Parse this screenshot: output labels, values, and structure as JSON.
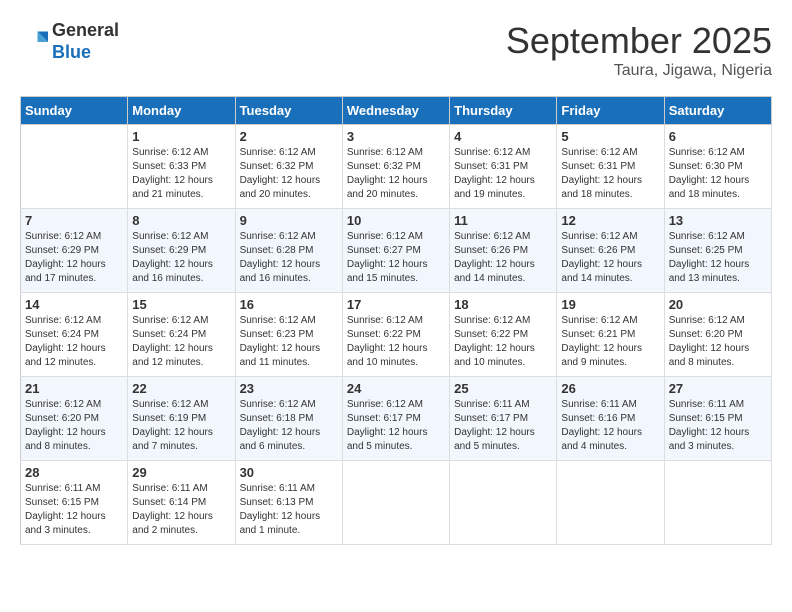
{
  "header": {
    "logo_general": "General",
    "logo_blue": "Blue",
    "month": "September 2025",
    "location": "Taura, Jigawa, Nigeria"
  },
  "weekdays": [
    "Sunday",
    "Monday",
    "Tuesday",
    "Wednesday",
    "Thursday",
    "Friday",
    "Saturday"
  ],
  "weeks": [
    [
      {
        "day": "",
        "info": ""
      },
      {
        "day": "1",
        "info": "Sunrise: 6:12 AM\nSunset: 6:33 PM\nDaylight: 12 hours\nand 21 minutes."
      },
      {
        "day": "2",
        "info": "Sunrise: 6:12 AM\nSunset: 6:32 PM\nDaylight: 12 hours\nand 20 minutes."
      },
      {
        "day": "3",
        "info": "Sunrise: 6:12 AM\nSunset: 6:32 PM\nDaylight: 12 hours\nand 20 minutes."
      },
      {
        "day": "4",
        "info": "Sunrise: 6:12 AM\nSunset: 6:31 PM\nDaylight: 12 hours\nand 19 minutes."
      },
      {
        "day": "5",
        "info": "Sunrise: 6:12 AM\nSunset: 6:31 PM\nDaylight: 12 hours\nand 18 minutes."
      },
      {
        "day": "6",
        "info": "Sunrise: 6:12 AM\nSunset: 6:30 PM\nDaylight: 12 hours\nand 18 minutes."
      }
    ],
    [
      {
        "day": "7",
        "info": "Sunrise: 6:12 AM\nSunset: 6:29 PM\nDaylight: 12 hours\nand 17 minutes."
      },
      {
        "day": "8",
        "info": "Sunrise: 6:12 AM\nSunset: 6:29 PM\nDaylight: 12 hours\nand 16 minutes."
      },
      {
        "day": "9",
        "info": "Sunrise: 6:12 AM\nSunset: 6:28 PM\nDaylight: 12 hours\nand 16 minutes."
      },
      {
        "day": "10",
        "info": "Sunrise: 6:12 AM\nSunset: 6:27 PM\nDaylight: 12 hours\nand 15 minutes."
      },
      {
        "day": "11",
        "info": "Sunrise: 6:12 AM\nSunset: 6:26 PM\nDaylight: 12 hours\nand 14 minutes."
      },
      {
        "day": "12",
        "info": "Sunrise: 6:12 AM\nSunset: 6:26 PM\nDaylight: 12 hours\nand 14 minutes."
      },
      {
        "day": "13",
        "info": "Sunrise: 6:12 AM\nSunset: 6:25 PM\nDaylight: 12 hours\nand 13 minutes."
      }
    ],
    [
      {
        "day": "14",
        "info": "Sunrise: 6:12 AM\nSunset: 6:24 PM\nDaylight: 12 hours\nand 12 minutes."
      },
      {
        "day": "15",
        "info": "Sunrise: 6:12 AM\nSunset: 6:24 PM\nDaylight: 12 hours\nand 12 minutes."
      },
      {
        "day": "16",
        "info": "Sunrise: 6:12 AM\nSunset: 6:23 PM\nDaylight: 12 hours\nand 11 minutes."
      },
      {
        "day": "17",
        "info": "Sunrise: 6:12 AM\nSunset: 6:22 PM\nDaylight: 12 hours\nand 10 minutes."
      },
      {
        "day": "18",
        "info": "Sunrise: 6:12 AM\nSunset: 6:22 PM\nDaylight: 12 hours\nand 10 minutes."
      },
      {
        "day": "19",
        "info": "Sunrise: 6:12 AM\nSunset: 6:21 PM\nDaylight: 12 hours\nand 9 minutes."
      },
      {
        "day": "20",
        "info": "Sunrise: 6:12 AM\nSunset: 6:20 PM\nDaylight: 12 hours\nand 8 minutes."
      }
    ],
    [
      {
        "day": "21",
        "info": "Sunrise: 6:12 AM\nSunset: 6:20 PM\nDaylight: 12 hours\nand 8 minutes."
      },
      {
        "day": "22",
        "info": "Sunrise: 6:12 AM\nSunset: 6:19 PM\nDaylight: 12 hours\nand 7 minutes."
      },
      {
        "day": "23",
        "info": "Sunrise: 6:12 AM\nSunset: 6:18 PM\nDaylight: 12 hours\nand 6 minutes."
      },
      {
        "day": "24",
        "info": "Sunrise: 6:12 AM\nSunset: 6:17 PM\nDaylight: 12 hours\nand 5 minutes."
      },
      {
        "day": "25",
        "info": "Sunrise: 6:11 AM\nSunset: 6:17 PM\nDaylight: 12 hours\nand 5 minutes."
      },
      {
        "day": "26",
        "info": "Sunrise: 6:11 AM\nSunset: 6:16 PM\nDaylight: 12 hours\nand 4 minutes."
      },
      {
        "day": "27",
        "info": "Sunrise: 6:11 AM\nSunset: 6:15 PM\nDaylight: 12 hours\nand 3 minutes."
      }
    ],
    [
      {
        "day": "28",
        "info": "Sunrise: 6:11 AM\nSunset: 6:15 PM\nDaylight: 12 hours\nand 3 minutes."
      },
      {
        "day": "29",
        "info": "Sunrise: 6:11 AM\nSunset: 6:14 PM\nDaylight: 12 hours\nand 2 minutes."
      },
      {
        "day": "30",
        "info": "Sunrise: 6:11 AM\nSunset: 6:13 PM\nDaylight: 12 hours\nand 1 minute."
      },
      {
        "day": "",
        "info": ""
      },
      {
        "day": "",
        "info": ""
      },
      {
        "day": "",
        "info": ""
      },
      {
        "day": "",
        "info": ""
      }
    ]
  ]
}
